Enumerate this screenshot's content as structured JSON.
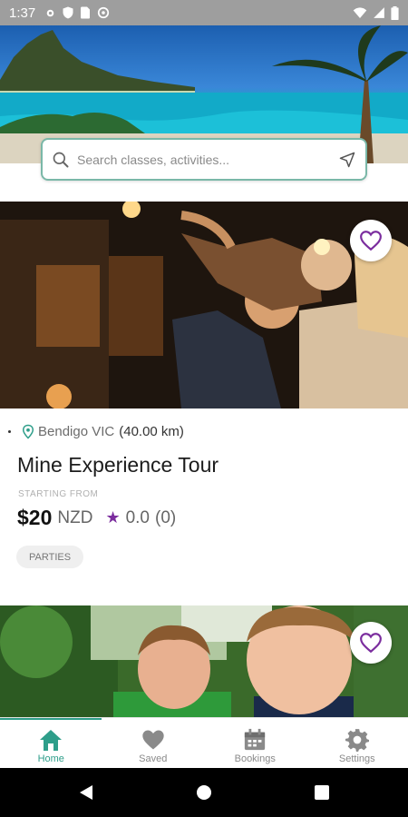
{
  "status_bar": {
    "time": "1:37"
  },
  "search": {
    "placeholder": "Search classes, activities..."
  },
  "listing": {
    "location": "Bendigo VIC",
    "distance": "(40.00 km)",
    "title": "Mine Experience Tour",
    "starting_label": "STARTING FROM",
    "price": "$20",
    "currency": "NZD",
    "rating": "0.0",
    "rating_count": "(0)",
    "tag": "PARTIES",
    "favorite_icon": "heart-outline-icon"
  },
  "nav": {
    "items": [
      {
        "label": "Home",
        "icon": "home-icon",
        "active": true
      },
      {
        "label": "Saved",
        "icon": "heart-icon",
        "active": false
      },
      {
        "label": "Bookings",
        "icon": "calendar-icon",
        "active": false
      },
      {
        "label": "Settings",
        "icon": "gear-icon",
        "active": false
      }
    ]
  },
  "colors": {
    "accent": "#2e9e8a",
    "favorite": "#7b2d9e",
    "status_bar": "#9e9e9e"
  }
}
